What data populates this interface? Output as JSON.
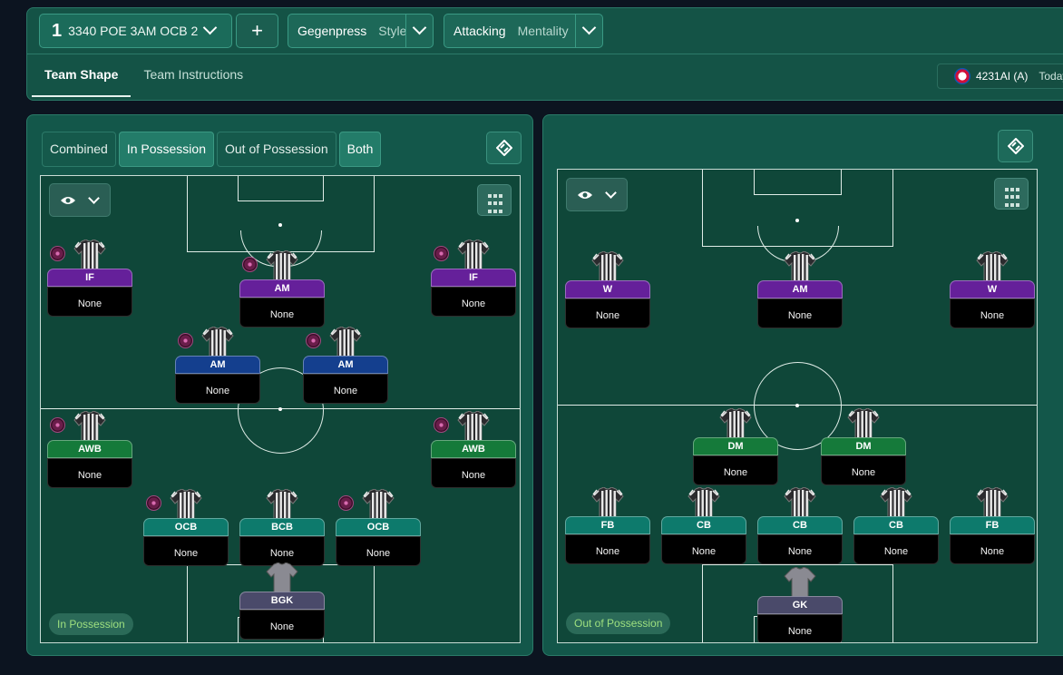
{
  "header": {
    "tactic_number": "1",
    "tactic_name": "3340 POE 3AM OCB 2",
    "add_label": "+",
    "style_value": "Gegenpress",
    "style_label": "Style",
    "mentality_value": "Attacking",
    "mentality_label": "Mentality",
    "tabs": [
      "Team Shape",
      "Team Instructions"
    ],
    "opponent": {
      "formation": "4231AI (A)",
      "when": "Today"
    }
  },
  "left_panel": {
    "mode_tabs": [
      "Combined",
      "In Possession",
      "Out of Possession",
      "Both"
    ],
    "phase_label": "In Possession",
    "players": [
      {
        "role": "IF",
        "duty": "None",
        "color": "#65209a"
      },
      {
        "role": "AM",
        "duty": "None",
        "color": "#65209a"
      },
      {
        "role": "IF",
        "duty": "None",
        "color": "#65209a"
      },
      {
        "role": "AM",
        "duty": "None",
        "color": "#143f8e"
      },
      {
        "role": "AM",
        "duty": "None",
        "color": "#143f8e"
      },
      {
        "role": "AWB",
        "duty": "None",
        "color": "#157a3a"
      },
      {
        "role": "AWB",
        "duty": "None",
        "color": "#157a3a"
      },
      {
        "role": "OCB",
        "duty": "None",
        "color": "#0d7a6c"
      },
      {
        "role": "BCB",
        "duty": "None",
        "color": "#0d7a6c"
      },
      {
        "role": "OCB",
        "duty": "None",
        "color": "#0d7a6c"
      },
      {
        "role": "BGK",
        "duty": "None",
        "color": "#4a4a6a"
      }
    ]
  },
  "right_panel": {
    "phase_label": "Out of Possession",
    "players": [
      {
        "role": "W",
        "duty": "None",
        "color": "#65209a"
      },
      {
        "role": "AM",
        "duty": "None",
        "color": "#65209a"
      },
      {
        "role": "W",
        "duty": "None",
        "color": "#65209a"
      },
      {
        "role": "DM",
        "duty": "None",
        "color": "#157a3a"
      },
      {
        "role": "DM",
        "duty": "None",
        "color": "#157a3a"
      },
      {
        "role": "FB",
        "duty": "None",
        "color": "#0d7a6c"
      },
      {
        "role": "CB",
        "duty": "None",
        "color": "#0d7a6c"
      },
      {
        "role": "CB",
        "duty": "None",
        "color": "#0d7a6c"
      },
      {
        "role": "CB",
        "duty": "None",
        "color": "#0d7a6c"
      },
      {
        "role": "FB",
        "duty": "None",
        "color": "#0d7a6c"
      },
      {
        "role": "GK",
        "duty": "None",
        "color": "#4a4a6a"
      }
    ]
  },
  "icons": [
    "chevron-down-icon",
    "plus-icon",
    "club-crest-icon",
    "eye-icon",
    "grid-icon",
    "tactics-board-icon",
    "player-shirt-icon",
    "key-player-icon"
  ]
}
